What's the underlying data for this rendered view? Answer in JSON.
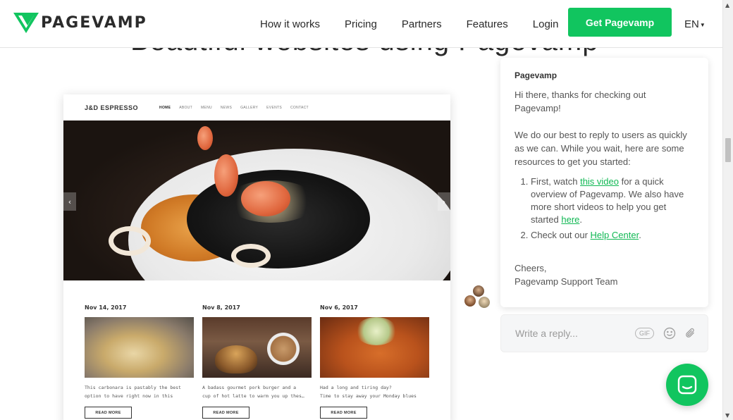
{
  "header": {
    "logo_text": "PAGEVAMP",
    "nav": [
      "How it works",
      "Pricing",
      "Partners",
      "Features",
      "Login"
    ],
    "cta_label": "Get Pagevamp",
    "language": "EN",
    "brand_color": "#11c55f"
  },
  "hero": {
    "title": "Beautiful websites using Pagevamp"
  },
  "preview": {
    "brand": "J&D ESPRESSO",
    "nav": [
      "HOME",
      "ABOUT",
      "MENU",
      "NEWS",
      "GALLERY",
      "EVENTS",
      "CONTACT"
    ],
    "arrow_prev": "‹",
    "arrow_next": "›",
    "posts": [
      {
        "date": "Nov 14, 2017",
        "line1": "This carbonara is pastably the best",
        "line2": "option to have right now in this",
        "button": "READ MORE"
      },
      {
        "date": "Nov 8, 2017",
        "line1": "A badass gourmet pork burger and a",
        "line2": "cup of hot latte to warm you up thes…",
        "button": "READ MORE"
      },
      {
        "date": "Nov 6, 2017",
        "line1": "Had a long and tiring day?",
        "line2": "Time to stay away your Monday blues",
        "button": "READ MORE"
      }
    ]
  },
  "chat": {
    "sender": "Pagevamp",
    "greeting": "Hi there, thanks for checking out Pagevamp!",
    "intro": "We do our best to reply to users as quickly as we can. While you wait, here are some resources to get you started:",
    "item1_before": "First, watch ",
    "item1_link": "this video",
    "item1_middle": " for a quick overview of Pagevamp. We also have more short videos to help you get started ",
    "item1_link2": "here",
    "item1_after": ".",
    "item2_before": "Check out our ",
    "item2_link": "Help Center",
    "item2_after": ".",
    "signoff": "Cheers,",
    "team": "Pagevamp Support Team",
    "reply_placeholder": "Write a reply...",
    "gif_label": "GIF",
    "icons": [
      "emoji-icon",
      "attachment-icon",
      "chat-launcher-icon"
    ]
  }
}
